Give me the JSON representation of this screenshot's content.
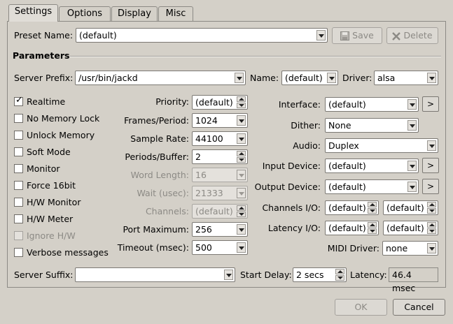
{
  "tabs": [
    {
      "label": "Settings",
      "active": true
    },
    {
      "label": "Options",
      "active": false
    },
    {
      "label": "Display",
      "active": false
    },
    {
      "label": "Misc",
      "active": false
    }
  ],
  "preset": {
    "label": "Preset Name:",
    "value": "(default)",
    "save_label": "Save",
    "delete_label": "Delete"
  },
  "parameters": {
    "heading": "Parameters"
  },
  "server": {
    "prefix_label": "Server Prefix:",
    "prefix_value": "/usr/bin/jackd",
    "name_label": "Name:",
    "name_value": "(default)",
    "driver_label": "Driver:",
    "driver_value": "alsa"
  },
  "checkboxes": [
    {
      "label": "Realtime",
      "checked": true,
      "disabled": false
    },
    {
      "label": "No Memory Lock",
      "checked": false,
      "disabled": false
    },
    {
      "label": "Unlock Memory",
      "checked": false,
      "disabled": false
    },
    {
      "label": "Soft Mode",
      "checked": false,
      "disabled": false
    },
    {
      "label": "Monitor",
      "checked": false,
      "disabled": false
    },
    {
      "label": "Force 16bit",
      "checked": false,
      "disabled": false
    },
    {
      "label": "H/W Monitor",
      "checked": false,
      "disabled": false
    },
    {
      "label": "H/W Meter",
      "checked": false,
      "disabled": false
    },
    {
      "label": "Ignore H/W",
      "checked": false,
      "disabled": true
    },
    {
      "label": "Verbose messages",
      "checked": false,
      "disabled": false
    }
  ],
  "mid": {
    "priority": {
      "label": "Priority:",
      "value": "(default)"
    },
    "frames_period": {
      "label": "Frames/Period:",
      "value": "1024"
    },
    "sample_rate": {
      "label": "Sample Rate:",
      "value": "44100"
    },
    "periods_buffer": {
      "label": "Periods/Buffer:",
      "value": "2"
    },
    "word_length": {
      "label": "Word Length:",
      "value": "16"
    },
    "wait": {
      "label": "Wait (usec):",
      "value": "21333"
    },
    "channels": {
      "label": "Channels:",
      "value": "(default)"
    },
    "port_maximum": {
      "label": "Port Maximum:",
      "value": "256"
    },
    "timeout": {
      "label": "Timeout (msec):",
      "value": "500"
    }
  },
  "right": {
    "interface": {
      "label": "Interface:",
      "value": "(default)"
    },
    "dither": {
      "label": "Dither:",
      "value": "None"
    },
    "audio": {
      "label": "Audio:",
      "value": "Duplex"
    },
    "input_device": {
      "label": "Input Device:",
      "value": "(default)"
    },
    "output_device": {
      "label": "Output Device:",
      "value": "(default)"
    },
    "channels_io": {
      "label": "Channels I/O:",
      "in": "(default)",
      "out": "(default)"
    },
    "latency_io": {
      "label": "Latency I/O:",
      "in": "(default)",
      "out": "(default)"
    },
    "midi_driver": {
      "label": "MIDI Driver:",
      "value": "none"
    },
    "arrow_button": ">"
  },
  "bottom": {
    "suffix_label": "Server Suffix:",
    "suffix_value": "",
    "start_delay_label": "Start Delay:",
    "start_delay_value": "2 secs",
    "latency_label": "Latency:",
    "latency_value": "46.4 msec"
  },
  "dialog": {
    "ok_label": "OK",
    "cancel_label": "Cancel"
  }
}
